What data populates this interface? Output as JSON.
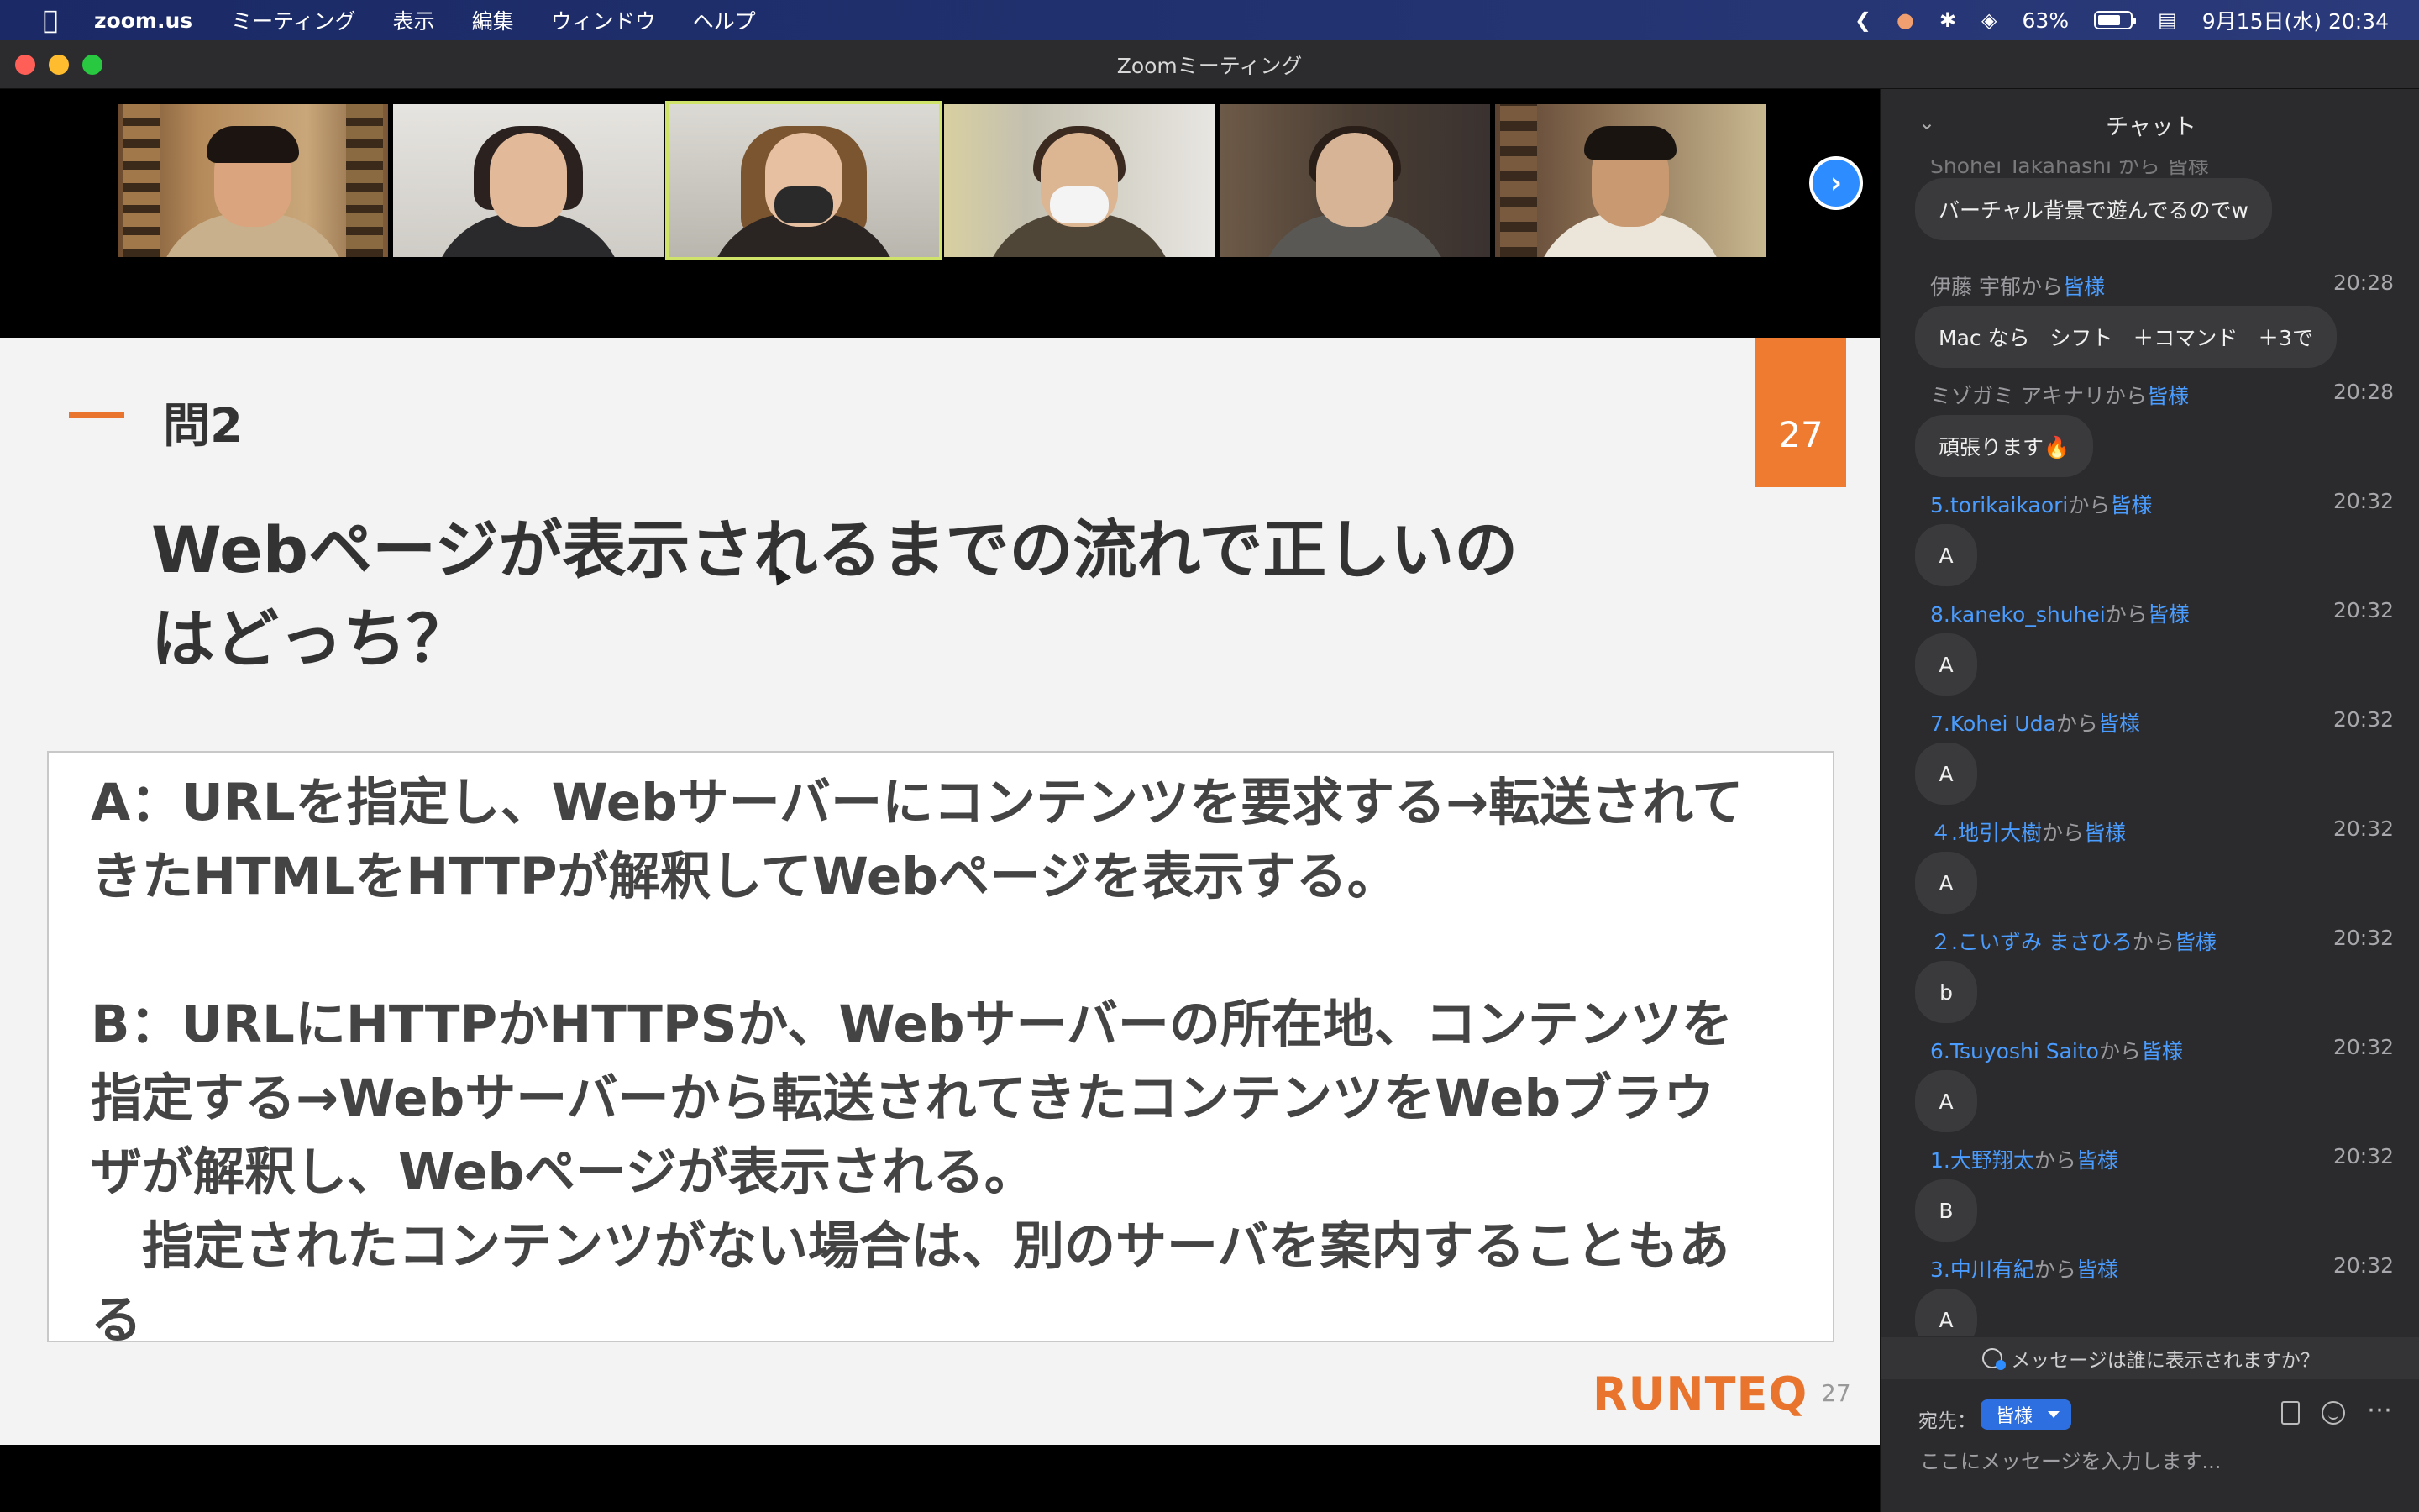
{
  "menubar": {
    "app": "zoom.us",
    "menus": [
      "ミーティング",
      "表示",
      "編集",
      "ウィンドウ",
      "ヘルプ"
    ],
    "battery": "63%",
    "datetime": "9月15日(水)  20:34"
  },
  "window": {
    "title": "Zoomミーティング"
  },
  "slide": {
    "question_number": "問2",
    "page_badge": "27",
    "question": "Webページが表示されるまでの流れで正しいの\nはどっち？",
    "answer_a": "A：URLを指定し、Webサーバーにコンテンツを要求する→転送されて\nきたHTMLをHTTPが解釈してWebページを表示する。",
    "answer_b": "B：URLにHTTPかHTTPSか、Webサーバーの所在地、コンテンツを\n指定する→Webサーバーから転送されてきたコンテンツをWebブラウ\nザが解釈し、Webページが表示される。\n　指定されたコンテンツがない場合は、別のサーバを案内することもあ\nる",
    "logo": "RUNTEQ",
    "footer_page": "27"
  },
  "chat": {
    "title": "チャット",
    "partial_top_sender": "Shohei Takahashi から 皆様",
    "first_bubble": "バーチャル背景で遊んでるのでw",
    "messages": [
      {
        "sender": "伊藤 宇郁",
        "from": "から",
        "to": "皆様",
        "time": "20:28",
        "text": "Mac なら   シフト   ＋コマンド   ＋3で"
      },
      {
        "sender": "ミゾガミ アキナリ",
        "from": "から",
        "to": "皆様",
        "time": "20:28",
        "text": "頑張ります🔥"
      },
      {
        "sender": "5.torikaikaori",
        "from": "から",
        "to": "皆様",
        "time": "20:32",
        "text": "A"
      },
      {
        "sender": "8.kaneko_shuhei",
        "from": "から",
        "to": "皆様",
        "time": "20:32",
        "text": "A"
      },
      {
        "sender": "7.Kohei Uda",
        "from": "から",
        "to": "皆様",
        "time": "20:32",
        "text": "A"
      },
      {
        "sender": "４.地引大樹",
        "from": "から",
        "to": "皆様",
        "time": "20:32",
        "text": "A"
      },
      {
        "sender": "２.こいずみ まさひろ",
        "from": "から",
        "to": "皆様",
        "time": "20:32",
        "text": "b"
      },
      {
        "sender": "6.Tsuyoshi Saito",
        "from": "から",
        "to": "皆様",
        "time": "20:32",
        "text": "A"
      },
      {
        "sender": "1.大野翔太",
        "from": "から",
        "to": "皆様",
        "time": "20:32",
        "text": "B"
      },
      {
        "sender": "3.中川有紀",
        "from": "から",
        "to": "皆様",
        "time": "20:32",
        "text": "A"
      }
    ],
    "visibility_note": "メッセージは誰に表示されますか？",
    "recipient_label": "宛先：",
    "recipient_value": "皆様",
    "input_placeholder": "ここにメッセージを入力します..."
  },
  "colors": {
    "accent_orange": "#e8742e",
    "zoom_blue": "#2d8cff",
    "chat_link": "#4a9cff"
  },
  "icons": [
    "apple-icon",
    "chevron-left-icon",
    "cat-icon",
    "bluetooth-icon",
    "wifi-icon",
    "battery-icon",
    "control-center-icon",
    "chevron-right-icon",
    "collapse-chevron-icon",
    "user-eye-icon",
    "file-icon",
    "emoji-icon",
    "more-icon"
  ]
}
